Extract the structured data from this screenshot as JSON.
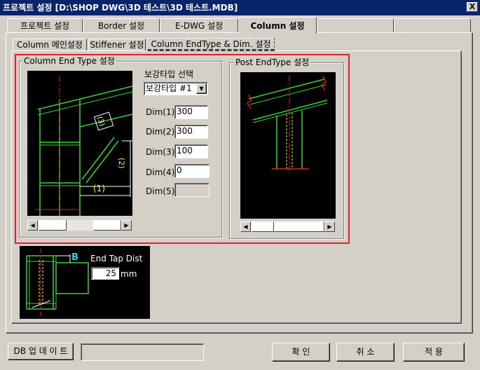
{
  "window": {
    "title": "프로젝트 설정  [D:\\SHOP DWG\\3D 테스트\\3D 테스트.MDB]",
    "close_label": "X"
  },
  "tabs": [
    {
      "label": "프로젝트 설정"
    },
    {
      "label": "Border 설정"
    },
    {
      "label": "E-DWG 설정"
    },
    {
      "label": "Column 설정"
    }
  ],
  "subtabs": [
    {
      "label": "Column 메인설정"
    },
    {
      "label": "Stiffener 설정"
    },
    {
      "label": "Column EndType & Dim. 설정"
    }
  ],
  "column_end": {
    "group_title": "Column End Type 설정",
    "reinforce_label": "보강타입 선택",
    "reinforce_value": "보강타입 #1",
    "dims": [
      {
        "label": "Dim(1)",
        "value": "300"
      },
      {
        "label": "Dim(2)",
        "value": "300"
      },
      {
        "label": "Dim(3)",
        "value": "100"
      },
      {
        "label": "Dim(4)",
        "value": "0"
      },
      {
        "label": "Dim(5)",
        "value": ""
      }
    ],
    "diagram_labels": {
      "d1": "(1)",
      "d2": "(2)",
      "d3": "(3)"
    }
  },
  "post_end": {
    "group_title": "Post EndType 설정"
  },
  "end_tap": {
    "label": "End Tap Dist",
    "value": "25",
    "unit": "mm",
    "marker": "B"
  },
  "footer": {
    "db_update_label": "DB 업 데 이 트",
    "status_text": "",
    "confirm_label": "확   인",
    "cancel_label": "취   소",
    "apply_label": "적   용"
  },
  "colors": {
    "accent_red": "#e0202c",
    "beam_green": "#3cd23c",
    "centerline_red": "#e8262a",
    "dim_white": "#ffffff",
    "label_yellow": "#e8e870",
    "marker_cyan": "#22d3ee"
  }
}
